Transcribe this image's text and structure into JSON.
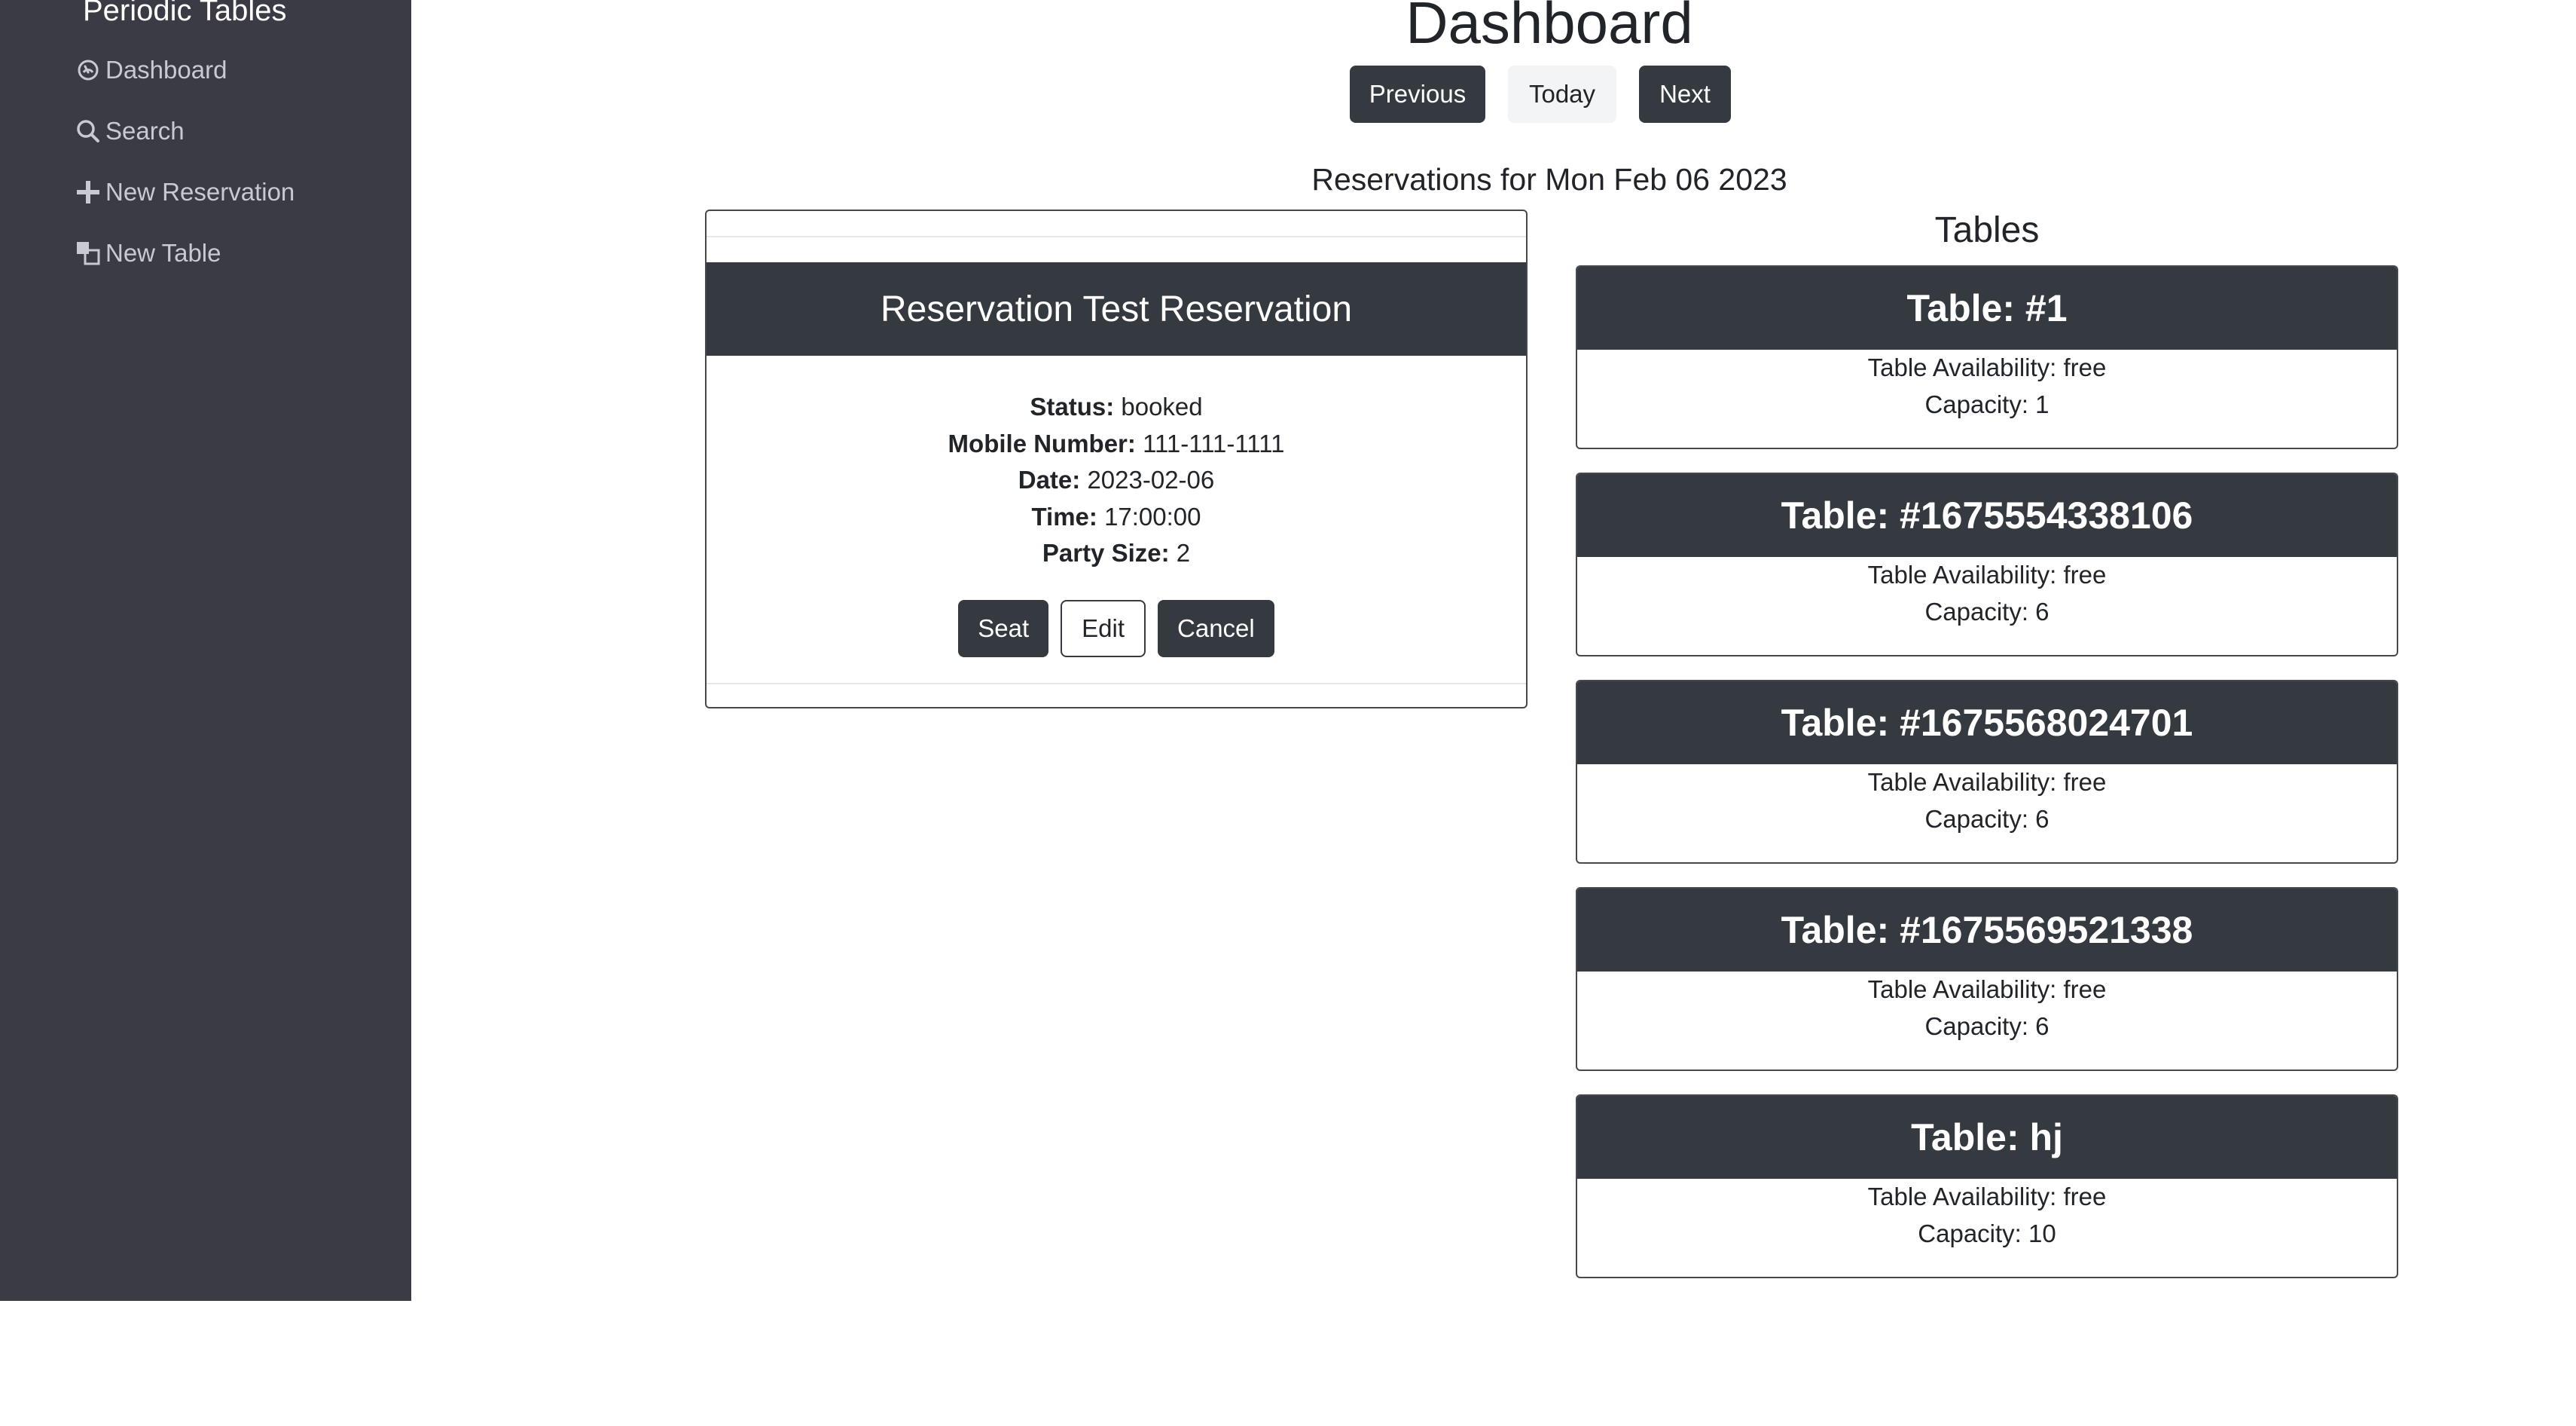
{
  "sidebar": {
    "brand": "Periodic Tables",
    "items": [
      {
        "label": "Dashboard",
        "icon": "dashboard-icon"
      },
      {
        "label": "Search",
        "icon": "search-icon"
      },
      {
        "label": "New Reservation",
        "icon": "plus-icon"
      },
      {
        "label": "New Table",
        "icon": "layers-icon"
      }
    ]
  },
  "main": {
    "title": "Dashboard",
    "nav": {
      "previous": "Previous",
      "today": "Today",
      "next": "Next"
    },
    "reservations_heading": "Reservations for Mon Feb 06 2023"
  },
  "reservation": {
    "title": "Reservation Test Reservation",
    "status_label": "Status:",
    "status": "booked",
    "mobile_label": "Mobile Number:",
    "mobile": "111-111-1111",
    "date_label": "Date:",
    "date": "2023-02-06",
    "time_label": "Time:",
    "time": "17:00:00",
    "party_label": "Party Size:",
    "party": "2",
    "actions": {
      "seat": "Seat",
      "edit": "Edit",
      "cancel": "Cancel"
    }
  },
  "tables": {
    "title": "Tables",
    "items": [
      {
        "name": "Table: #1",
        "availability": "Table Availability: free",
        "capacity": "Capacity: 1"
      },
      {
        "name": "Table: #1675554338106",
        "availability": "Table Availability: free",
        "capacity": "Capacity: 6"
      },
      {
        "name": "Table: #1675568024701",
        "availability": "Table Availability: free",
        "capacity": "Capacity: 6"
      },
      {
        "name": "Table: #1675569521338",
        "availability": "Table Availability: free",
        "capacity": "Capacity: 6"
      },
      {
        "name": "Table: hj",
        "availability": "Table Availability: free",
        "capacity": "Capacity: 10"
      }
    ]
  },
  "colors": {
    "sidebar_bg": "#3a3b45",
    "dark": "#343a40",
    "nav_text": "#c8cad2"
  }
}
